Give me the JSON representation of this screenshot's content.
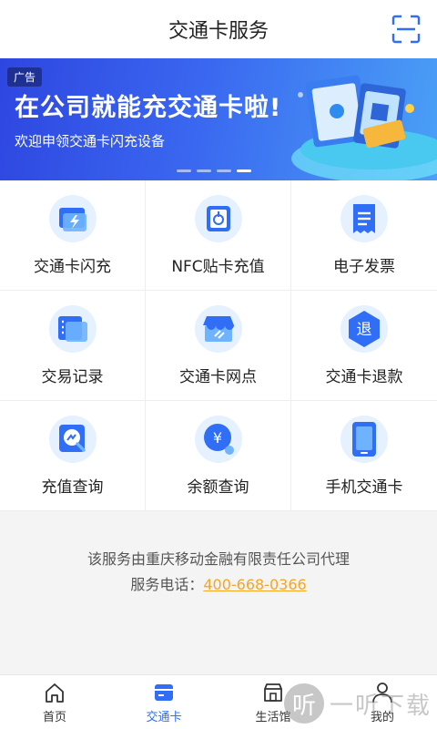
{
  "header": {
    "title": "交通卡服务",
    "scan_icon": "scan-icon"
  },
  "banner": {
    "ad_label": "广告",
    "headline": "在公司就能充交通卡啦!",
    "subtitle": "欢迎申领交通卡闪充设备",
    "slides": 4,
    "active_slide": 4
  },
  "services": [
    {
      "label": "交通卡闪充",
      "icon": "lightning-card-icon"
    },
    {
      "label": "NFC贴卡充值",
      "icon": "nfc-tap-icon"
    },
    {
      "label": "电子发票",
      "icon": "receipt-icon"
    },
    {
      "label": "交易记录",
      "icon": "records-icon"
    },
    {
      "label": "交通卡网点",
      "icon": "store-icon"
    },
    {
      "label": "交通卡退款",
      "icon": "refund-icon"
    },
    {
      "label": "充值查询",
      "icon": "search-icon"
    },
    {
      "label": "余额查询",
      "icon": "yuan-coin-icon"
    },
    {
      "label": "手机交通卡",
      "icon": "phone-card-icon"
    }
  ],
  "info": {
    "line1": "该服务由重庆移动金融有限责任公司代理",
    "phone_label": "服务电话：",
    "phone": "400-668-0366"
  },
  "tabbar": [
    {
      "label": "首页",
      "icon": "home-icon",
      "active": false
    },
    {
      "label": "交通卡",
      "icon": "card-icon",
      "active": true
    },
    {
      "label": "生活馆",
      "icon": "shop-icon",
      "active": false
    },
    {
      "label": "我的",
      "icon": "user-icon",
      "active": false
    }
  ],
  "watermark": {
    "glyph": "听",
    "text": "一听下载"
  },
  "colors": {
    "accent": "#2f6ef5",
    "phone": "#f5a623",
    "banner_start": "#2e46e0",
    "banner_end": "#4aa0f6"
  }
}
